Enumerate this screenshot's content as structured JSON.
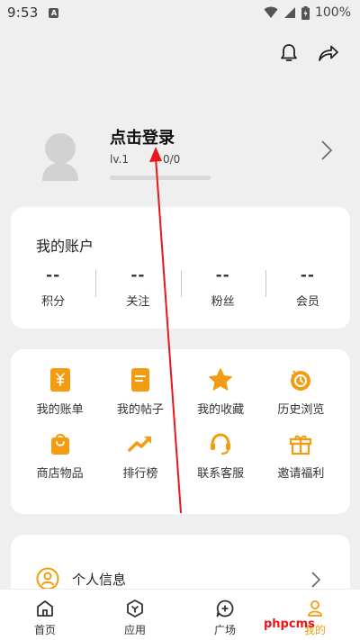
{
  "status_bar": {
    "time": "9:53",
    "battery": "100%"
  },
  "profile": {
    "login_text": "点击登录",
    "level": "lv.1",
    "exp": "0/0",
    "level_progress": 0
  },
  "account": {
    "title": "我的账户",
    "stats": [
      {
        "value": "--",
        "label": "积分"
      },
      {
        "value": "--",
        "label": "关注"
      },
      {
        "value": "--",
        "label": "粉丝"
      },
      {
        "value": "--",
        "label": "会员"
      }
    ]
  },
  "features": [
    {
      "label": "我的账单",
      "icon": "bill-icon"
    },
    {
      "label": "我的帖子",
      "icon": "post-icon"
    },
    {
      "label": "我的收藏",
      "icon": "star-icon"
    },
    {
      "label": "历史浏览",
      "icon": "history-icon"
    },
    {
      "label": "商店物品",
      "icon": "shop-bag-icon"
    },
    {
      "label": "排行榜",
      "icon": "trend-icon"
    },
    {
      "label": "联系客服",
      "icon": "headset-icon"
    },
    {
      "label": "邀请福利",
      "icon": "gift-icon"
    }
  ],
  "info_row": {
    "label": "个人信息"
  },
  "bottom_nav": [
    {
      "label": "首页",
      "icon": "home-icon",
      "active": false
    },
    {
      "label": "应用",
      "icon": "apps-icon",
      "active": false
    },
    {
      "label": "广场",
      "icon": "plaza-icon",
      "active": false
    },
    {
      "label": "我的",
      "icon": "profile-icon",
      "active": true
    }
  ],
  "watermark": "phpcms",
  "colors": {
    "accent": "#f39c12",
    "annotation": "#e8171d",
    "background": "#efefef"
  }
}
